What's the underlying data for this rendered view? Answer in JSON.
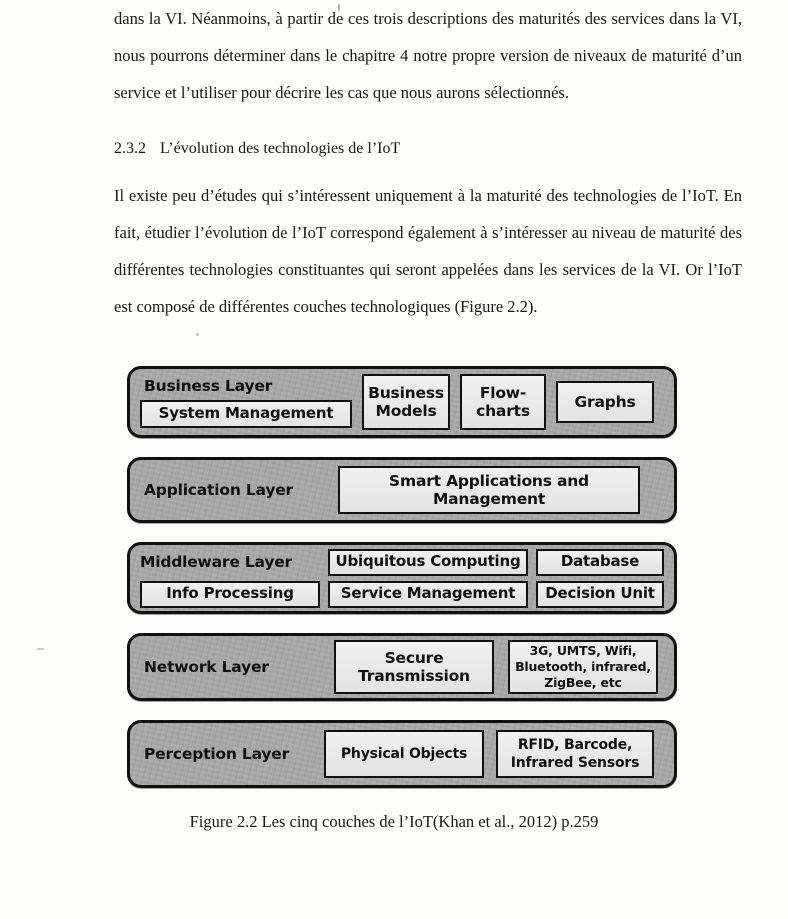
{
  "document": {
    "paragraph_1": "dans la VI. Néanmoins, à partir de ces trois descriptions des maturités des services dans la VI, nous pourrons déterminer dans le chapitre 4 notre propre version de niveaux de maturité d’un service et l’utiliser pour décrire les cas que nous aurons sélectionnés.",
    "heading": {
      "number": "2.3.2",
      "text": "L’évolution des technologies de l’IoT"
    },
    "paragraph_2": "Il existe peu d’études qui s’intéressent uniquement à la maturité des technologies de l’IoT. En fait, étudier l’évolution de l’IoT correspond également à s’intéresser au niveau de maturité des différentes technologies constituantes qui seront appelées dans les services de la VI. Or l’IoT est composé de différentes couches technologiques (Figure 2.2).",
    "figure_caption": "Figure 2.2 Les cinq couches de l’IoT(Khan et al., 2012) p.259"
  },
  "figure": {
    "layers": [
      {
        "id": "business",
        "title": "Business Layer",
        "cells": [
          "System Management",
          "Business Models",
          "Flow-charts",
          "Graphs"
        ],
        "cell_lines": {
          "system_management": "System Management",
          "business_models_line1": "Business",
          "business_models_line2": "Models",
          "flowcharts_line1": "Flow-",
          "flowcharts_line2": "charts",
          "graphs": "Graphs"
        }
      },
      {
        "id": "application",
        "title": "Application Layer",
        "cells": [
          "Smart Applications and Management"
        ],
        "cell_lines": {
          "smart_line1": "Smart Applications and",
          "smart_line2": "Management"
        }
      },
      {
        "id": "middleware",
        "title": "Middleware Layer",
        "cells": [
          "Ubiquitous Computing",
          "Database",
          "Info Processing",
          "Service Management",
          "Decision Unit"
        ],
        "cell_lines": {
          "ubiquitous": "Ubiquitous Computing",
          "database": "Database",
          "info_processing": "Info Processing",
          "service_management": "Service Management",
          "decision_unit": "Decision Unit"
        }
      },
      {
        "id": "network",
        "title": "Network Layer",
        "cells": [
          "Secure Transmission",
          "3G, UMTS, Wifi, Bluetooth, infrared, ZigBee, etc"
        ],
        "cell_lines": {
          "secure_line1": "Secure",
          "secure_line2": "Transmission",
          "tech_line1": "3G, UMTS, Wifi,",
          "tech_line2": "Bluetooth, infrared,",
          "tech_line3": "ZigBee, etc"
        }
      },
      {
        "id": "perception",
        "title": "Perception Layer",
        "cells": [
          "Physical Objects",
          "RFID, Barcode, Infrared Sensors"
        ],
        "cell_lines": {
          "physical_objects": "Physical Objects",
          "tech_line1": "RFID, Barcode,",
          "tech_line2": "Infrared Sensors"
        }
      }
    ],
    "colors": {
      "container_fill": "#a9a9a9",
      "cell_fill": "#dedede",
      "border": "#111111",
      "text": "#101010",
      "page_background": "#fdfdfc"
    }
  }
}
